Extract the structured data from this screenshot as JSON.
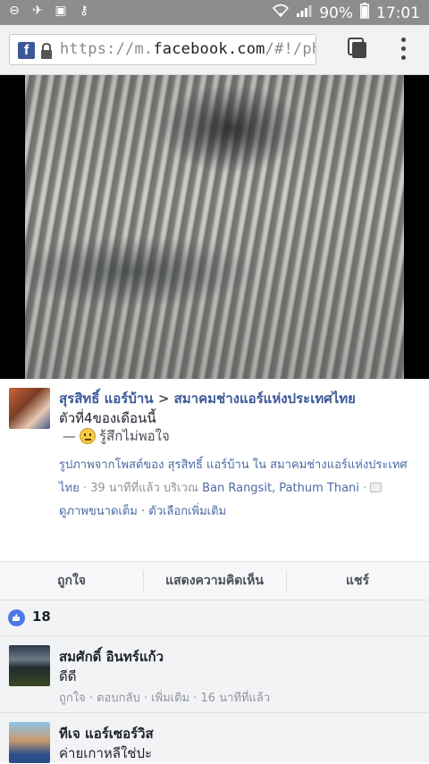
{
  "statusbar": {
    "battery": "90%",
    "time": "17:01"
  },
  "browser": {
    "url_prefix": "https://m.",
    "url_domain": "facebook.com",
    "url_suffix": "/#!/photo.p"
  },
  "post": {
    "author": "สุรสิทธิ์ แอร์บ้าน",
    "separator": ">",
    "group": "สมาคมช่างแอร์แห่งประเทศไทย",
    "text": "ตัวที่4ของเดือนนี้",
    "feeling_dash": "—",
    "feeling": "รู้สึกไม่พอใจ",
    "meta_line1": "รูปภาพจากโพสต์ของ สุรสิทธิ์ แอร์บ้าน ใน สมาคมช่างแอร์แห่งประเทศ",
    "meta_line2_group": "ไทย",
    "meta_line2_time": " · 39 นาทีที่แล้ว บริเวณ ",
    "meta_line2_place": "Ban Rangsit, Pathum Thani",
    "meta_line2_end": " · ",
    "meta_line3": "ดูภาพขนาดเต็ม · ตัวเลือกเพิ่มเติม"
  },
  "actions": {
    "like": "ถูกใจ",
    "comment": "แสดงความคิดเห็น",
    "share": "แชร์"
  },
  "likes": {
    "count": "18"
  },
  "comments": [
    {
      "name": "สมศักดิ์ อินทร์แก้ว",
      "text": "ดีดี",
      "meta": "ถูกใจ · ตอบกลับ · เพิ่มเติม · 16 นาทีที่แล้ว"
    },
    {
      "name": "ทีเจ แอร์เซอร์วิส",
      "text": "ค่ายเกาหลีใช่ปะ"
    }
  ],
  "colors": {
    "facebook_blue": "#3b5998",
    "like_blue": "#4b78e6",
    "statusbar_gray": "#8d8d8d"
  }
}
